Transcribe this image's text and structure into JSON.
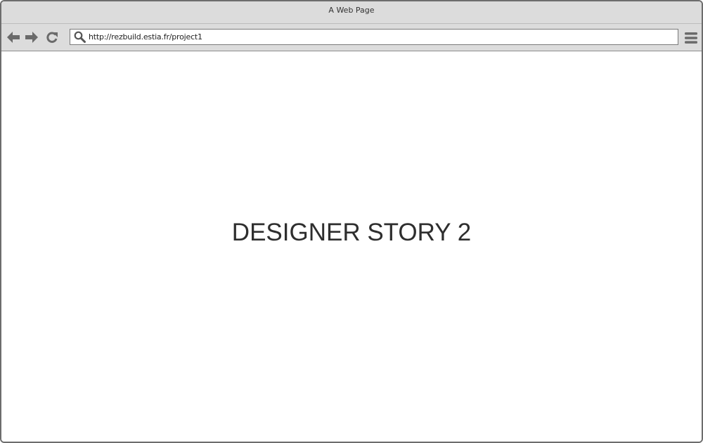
{
  "window": {
    "title": "A Web Page"
  },
  "toolbar": {
    "back_icon": "arrow-left-icon",
    "forward_icon": "arrow-right-icon",
    "reload_icon": "reload-icon",
    "search_icon": "search-icon",
    "menu_icon": "hamburger-menu-icon",
    "url": "http://rezbuild.estia.fr/project1"
  },
  "page": {
    "headline": "DESIGNER STORY 2"
  },
  "colors": {
    "chrome_bg": "#dcdcdc",
    "icon": "#6a6a6a",
    "text": "#2e2e2e"
  }
}
